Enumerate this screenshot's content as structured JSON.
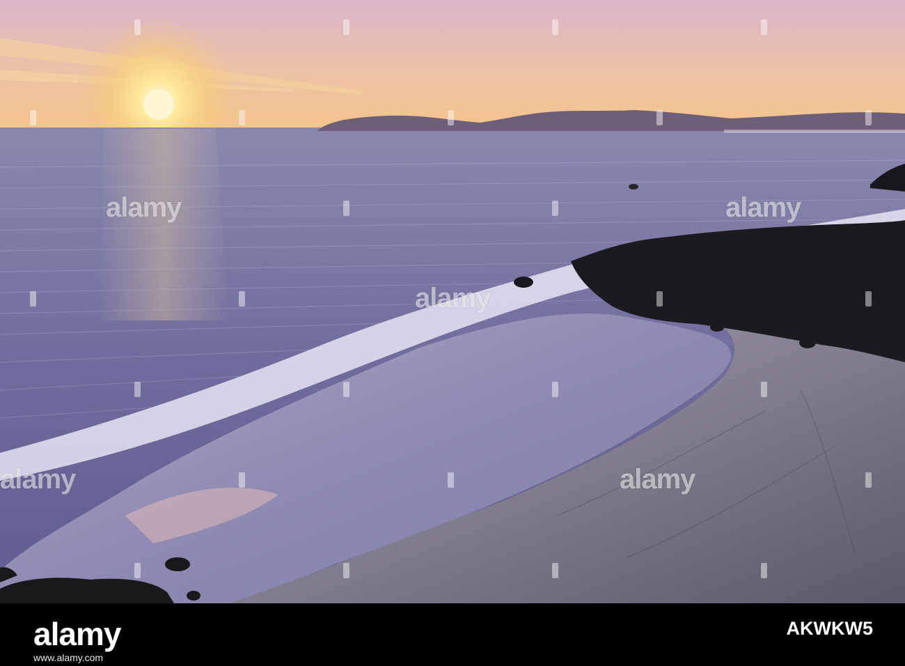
{
  "image": {
    "scene": "Sunset over a sandy ocean beach with rocks and a distant headland",
    "colors": {
      "sky_top": "#d9b7c7",
      "sky_horizon": "#f3c98a",
      "sun": "#fff4c6",
      "sea": "#6f6e9c",
      "sand": "#a9a3b8",
      "rocks": "#1d1a1f",
      "footer": "#000000"
    }
  },
  "watermarks": {
    "word": "alamy"
  },
  "footer": {
    "logo": "alamy",
    "url": "www.alamy.com",
    "image_id": "AKWKW5"
  }
}
